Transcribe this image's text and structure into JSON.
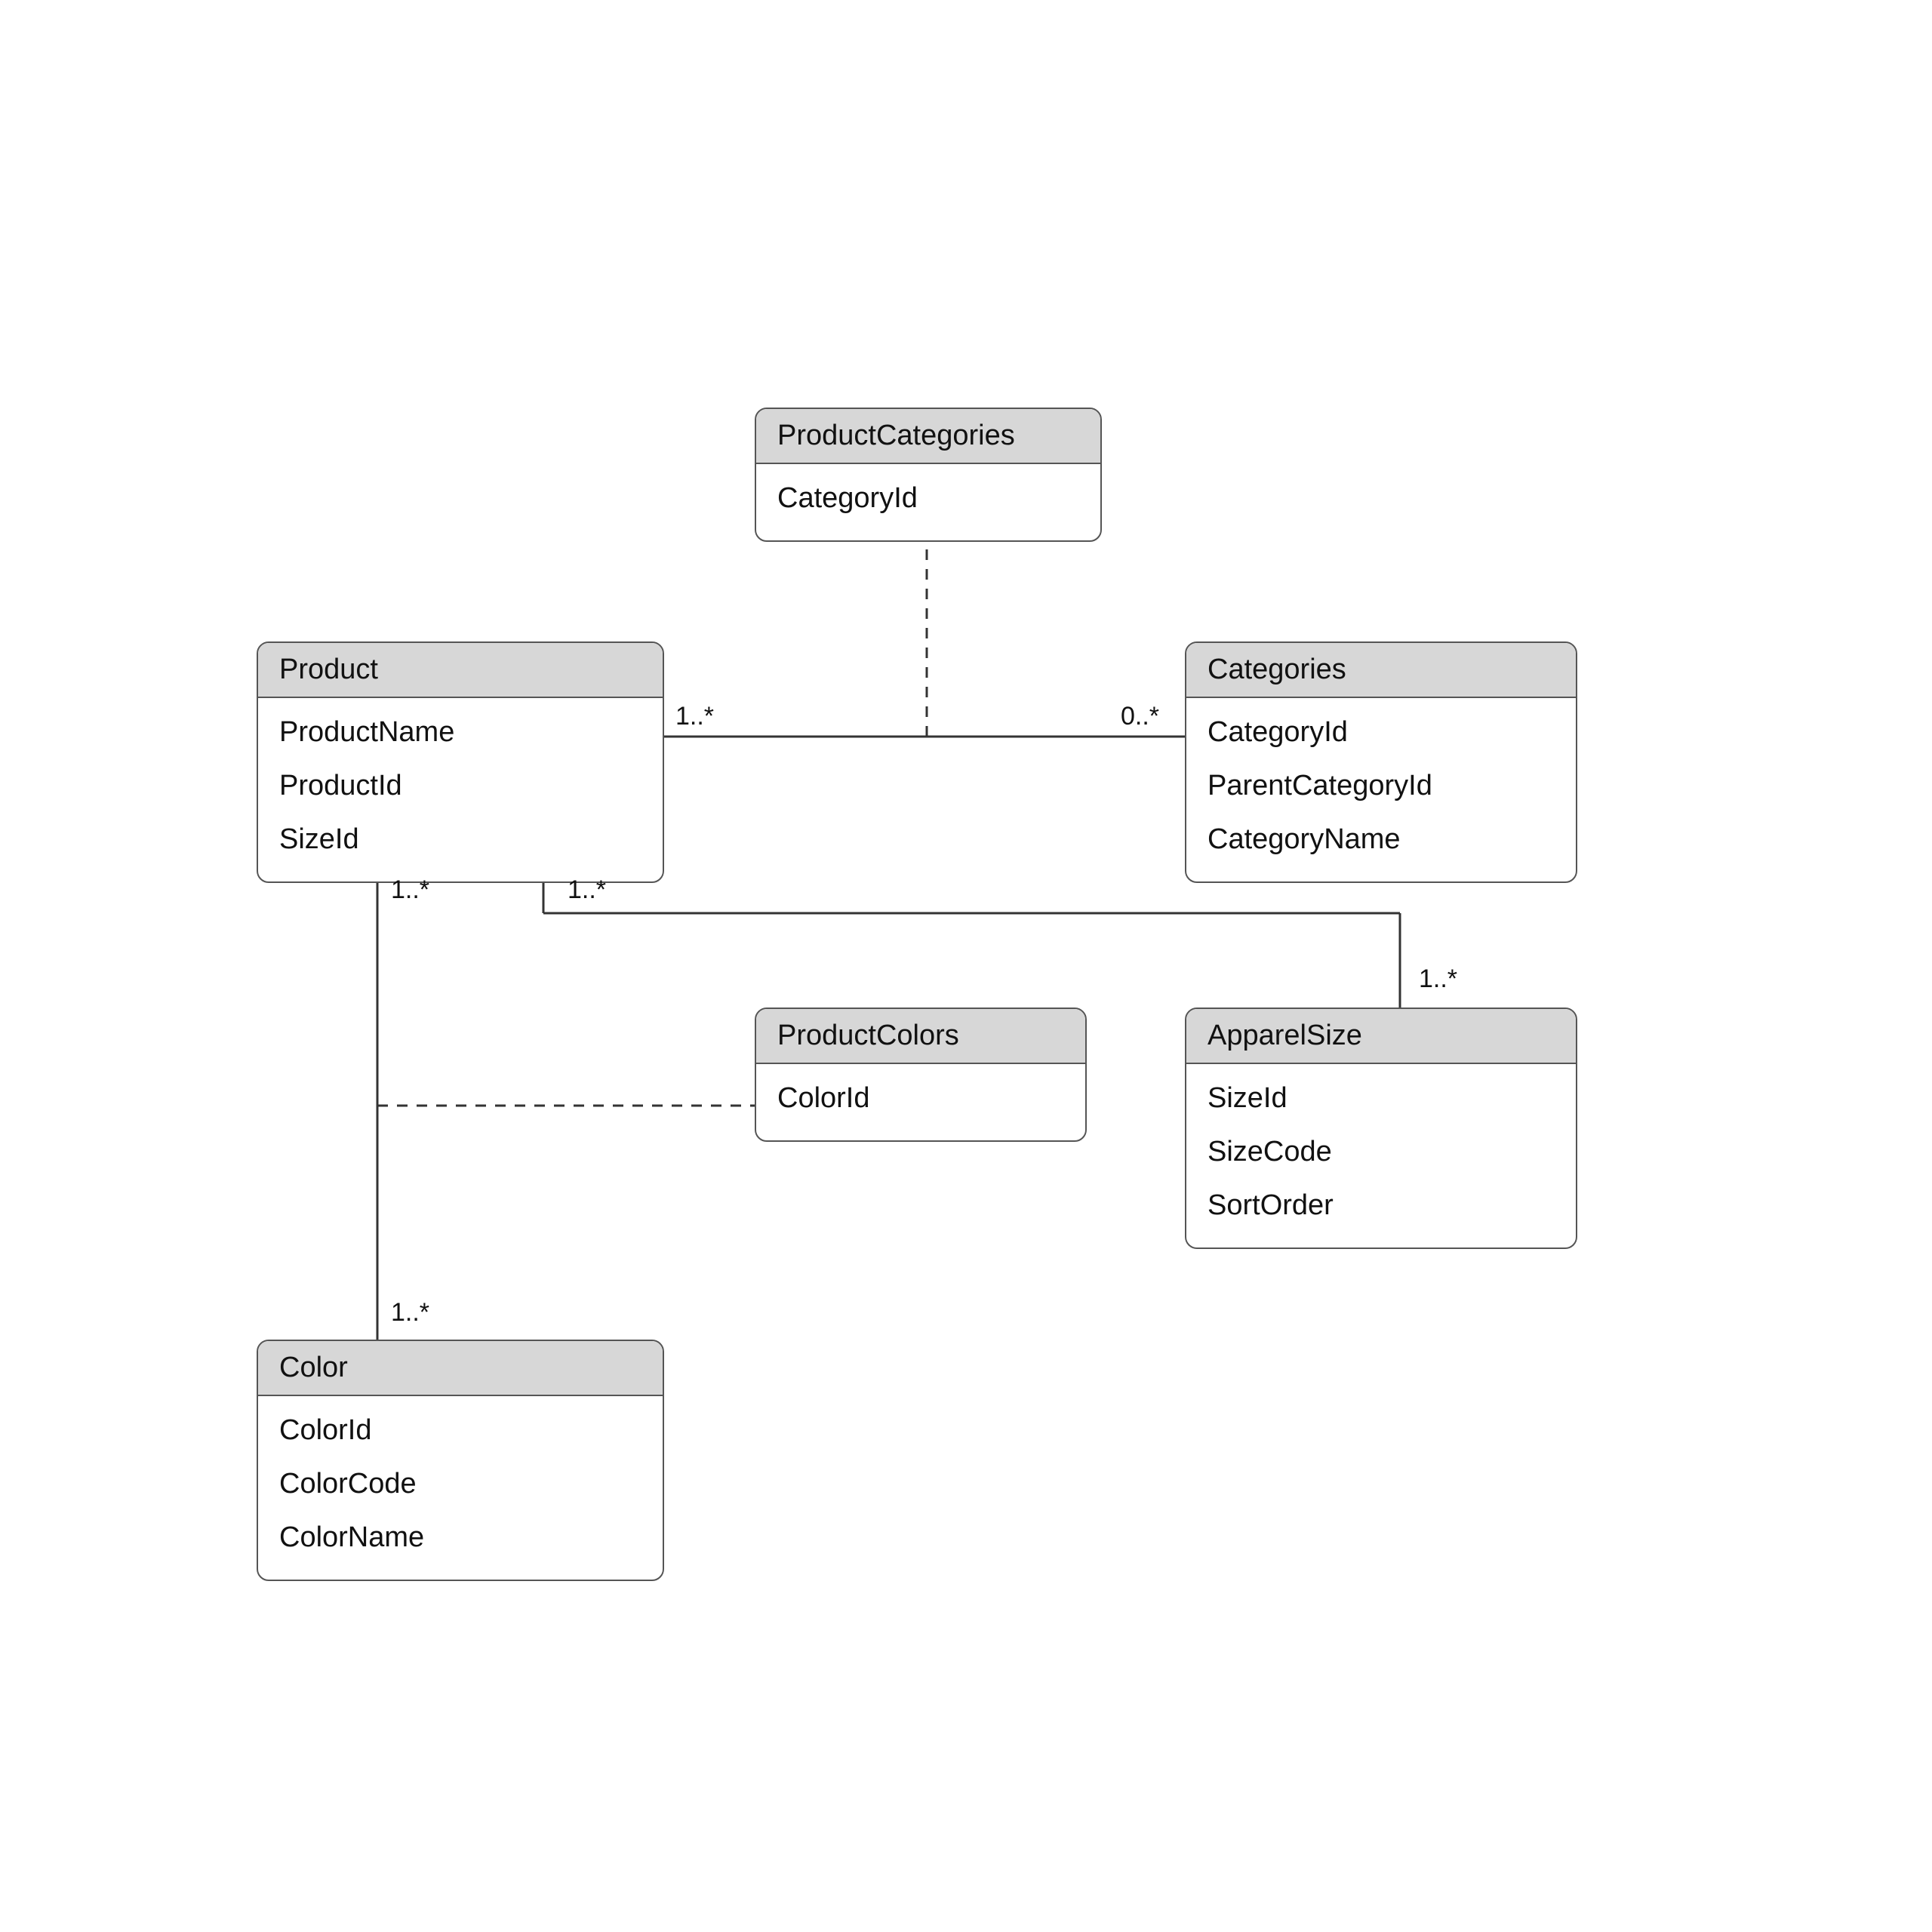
{
  "entities": {
    "productCategories": {
      "title": "ProductCategories",
      "attrs": [
        "CategoryId"
      ]
    },
    "product": {
      "title": "Product",
      "attrs": [
        "ProductName",
        "ProductId",
        "SizeId"
      ]
    },
    "categories": {
      "title": "Categories",
      "attrs": [
        "CategoryId",
        "ParentCategoryId",
        "CategoryName"
      ]
    },
    "productColors": {
      "title": "ProductColors",
      "attrs": [
        "ColorId"
      ]
    },
    "apparelSize": {
      "title": "ApparelSize",
      "attrs": [
        "SizeId",
        "SizeCode",
        "SortOrder"
      ]
    },
    "color": {
      "title": "Color",
      "attrs": [
        "ColorId",
        "ColorCode",
        "ColorName"
      ]
    }
  },
  "mult": {
    "prod_cat_left": "1..*",
    "prod_cat_right": "0..*",
    "prod_color_top": "1..*",
    "prod_color_bot": "1..*",
    "prod_size_left": "1..*",
    "prod_size_right": "1..*"
  }
}
